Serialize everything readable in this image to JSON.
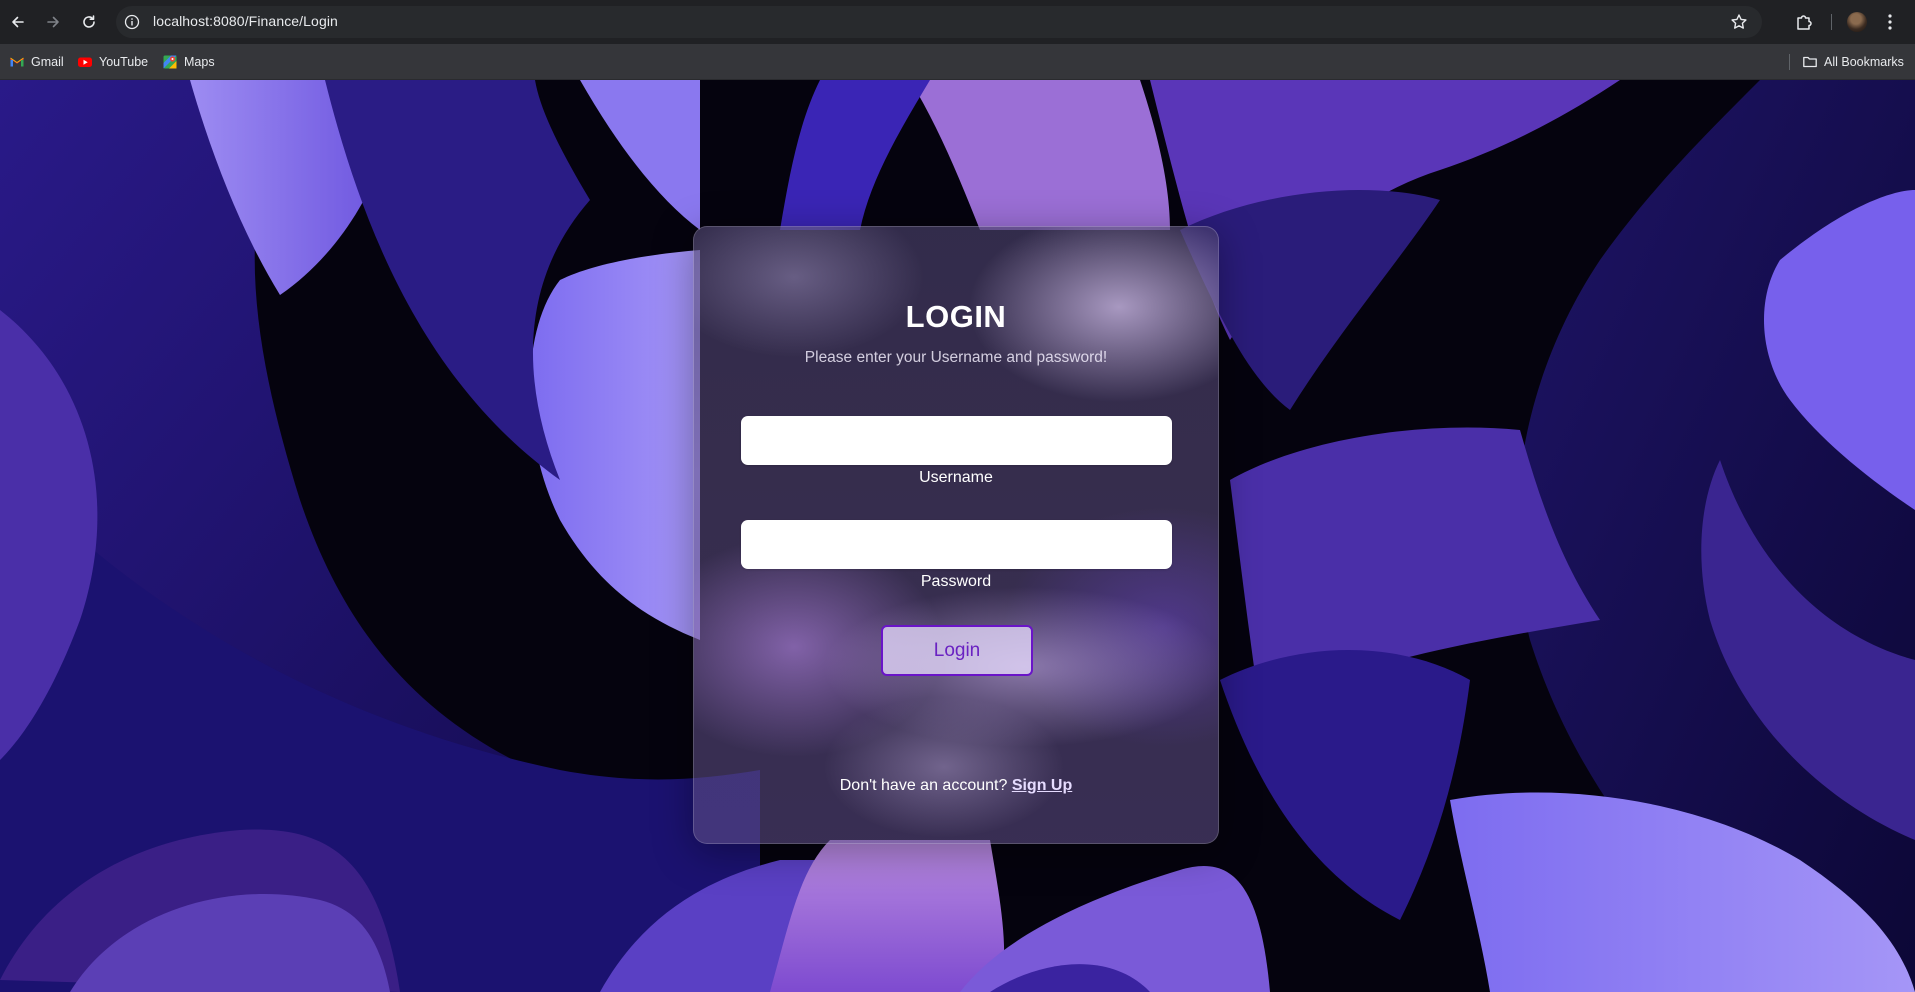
{
  "browser": {
    "url": "localhost:8080/Finance/Login",
    "bookmarks": [
      {
        "label": "Gmail",
        "icon": "gmail-icon"
      },
      {
        "label": "YouTube",
        "icon": "youtube-icon"
      },
      {
        "label": "Maps",
        "icon": "maps-icon"
      }
    ],
    "all_bookmarks_label": "All Bookmarks"
  },
  "login": {
    "title": "LOGIN",
    "subtitle": "Please enter your Username and password!",
    "username_label": "Username",
    "username_value": "",
    "password_label": "Password",
    "password_value": "",
    "button_label": "Login",
    "signup_prompt": "Don't have an account?",
    "signup_link": "Sign Up"
  },
  "colors": {
    "button_border": "#6a14c8",
    "button_text": "#6a22c2",
    "background_dark": "#05030e",
    "background_purple": "#6b55e0"
  }
}
